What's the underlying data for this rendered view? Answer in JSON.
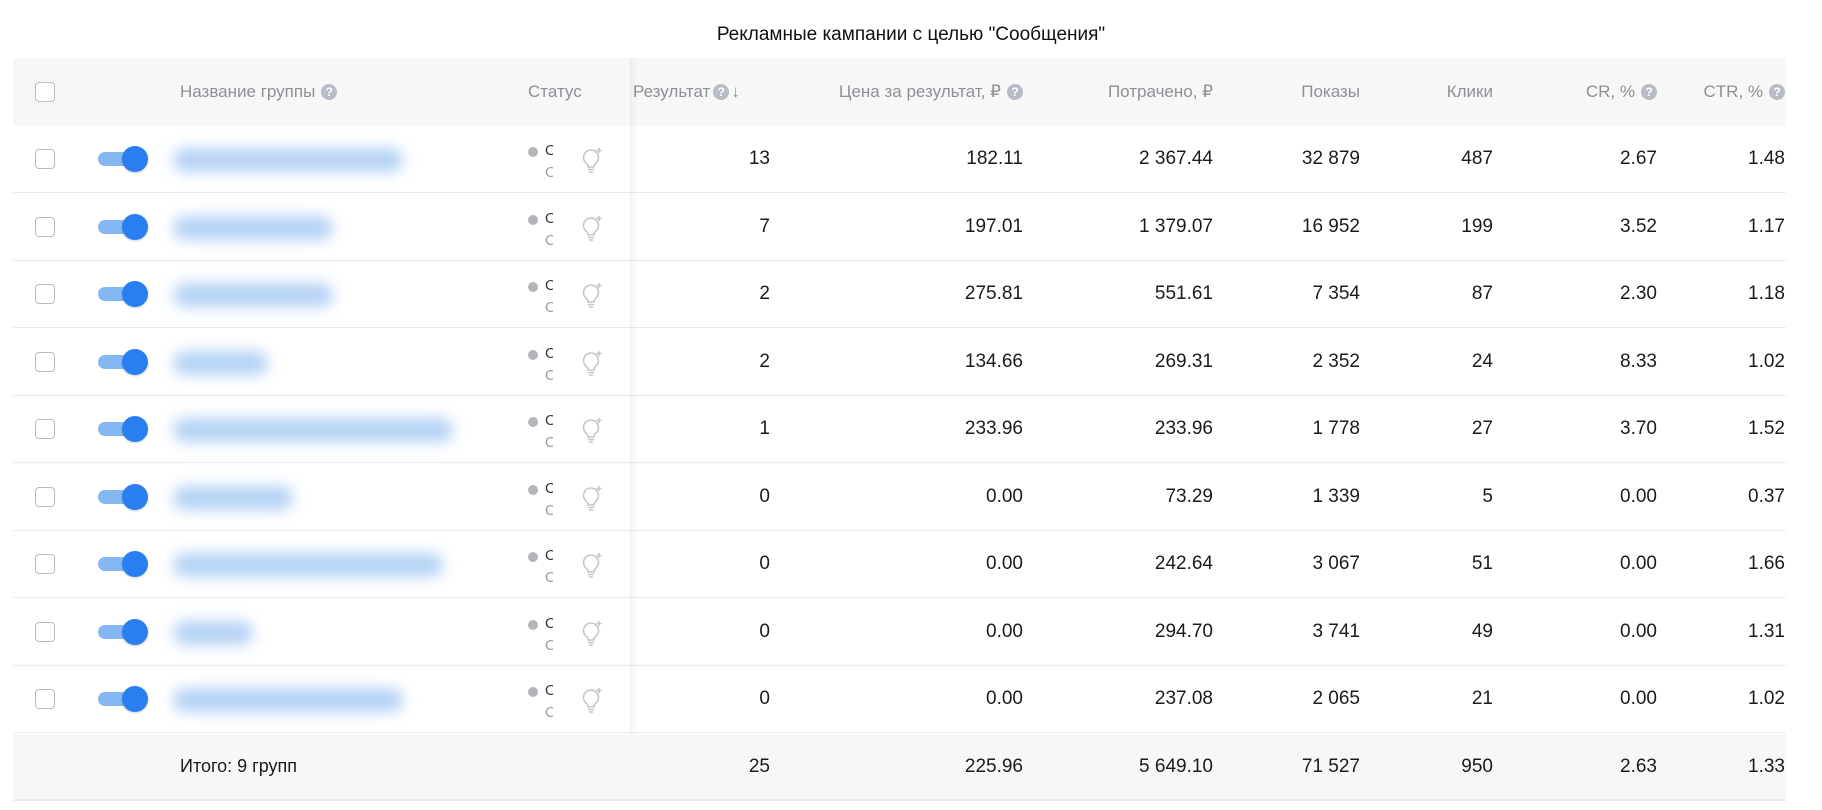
{
  "page": {
    "title": "Рекламные кампании с целью \"Сообщения\""
  },
  "colors": {
    "accent": "#2a7ff0",
    "toggle_track": "#85b8f3",
    "header_bg": "#f7f7f8",
    "header_text": "#8e9096"
  },
  "header": {
    "name": "Название группы",
    "status": "Статус",
    "result": "Результат",
    "sort_indicator": "↓",
    "price": "Цена за результат, ₽",
    "spent": "Потрачено, ₽",
    "impressions": "Показы",
    "clicks": "Клики",
    "cr": "CR, %",
    "ctr": "CTR, %",
    "help_glyph": "?"
  },
  "icons": {
    "help": "help-circle-icon",
    "sort": "sort-down-icon",
    "status_hint": "lightbulb-sparkle-icon"
  },
  "status_fragment": {
    "line1": "О",
    "line2": "О"
  },
  "rows": [
    {
      "enabled": true,
      "result": "13",
      "price": "182.11",
      "spent": "2 367.44",
      "impressions": "32 879",
      "clicks": "487",
      "cr": "2.67",
      "ctr": "1.48"
    },
    {
      "enabled": true,
      "result": "7",
      "price": "197.01",
      "spent": "1 379.07",
      "impressions": "16 952",
      "clicks": "199",
      "cr": "3.52",
      "ctr": "1.17"
    },
    {
      "enabled": true,
      "result": "2",
      "price": "275.81",
      "spent": "551.61",
      "impressions": "7 354",
      "clicks": "87",
      "cr": "2.30",
      "ctr": "1.18"
    },
    {
      "enabled": true,
      "result": "2",
      "price": "134.66",
      "spent": "269.31",
      "impressions": "2 352",
      "clicks": "24",
      "cr": "8.33",
      "ctr": "1.02"
    },
    {
      "enabled": true,
      "result": "1",
      "price": "233.96",
      "spent": "233.96",
      "impressions": "1 778",
      "clicks": "27",
      "cr": "3.70",
      "ctr": "1.52"
    },
    {
      "enabled": true,
      "result": "0",
      "price": "0.00",
      "spent": "73.29",
      "impressions": "1 339",
      "clicks": "5",
      "cr": "0.00",
      "ctr": "0.37"
    },
    {
      "enabled": true,
      "result": "0",
      "price": "0.00",
      "spent": "242.64",
      "impressions": "3 067",
      "clicks": "51",
      "cr": "0.00",
      "ctr": "1.66"
    },
    {
      "enabled": true,
      "result": "0",
      "price": "0.00",
      "spent": "294.70",
      "impressions": "3 741",
      "clicks": "49",
      "cr": "0.00",
      "ctr": "1.31"
    },
    {
      "enabled": true,
      "result": "0",
      "price": "0.00",
      "spent": "237.08",
      "impressions": "2 065",
      "clicks": "21",
      "cr": "0.00",
      "ctr": "1.02"
    }
  ],
  "total": {
    "label": "Итого: 9 групп",
    "result": "25",
    "price": "225.96",
    "spent": "5 649.10",
    "impressions": "71 527",
    "clicks": "950",
    "cr": "2.63",
    "ctr": "1.33"
  }
}
